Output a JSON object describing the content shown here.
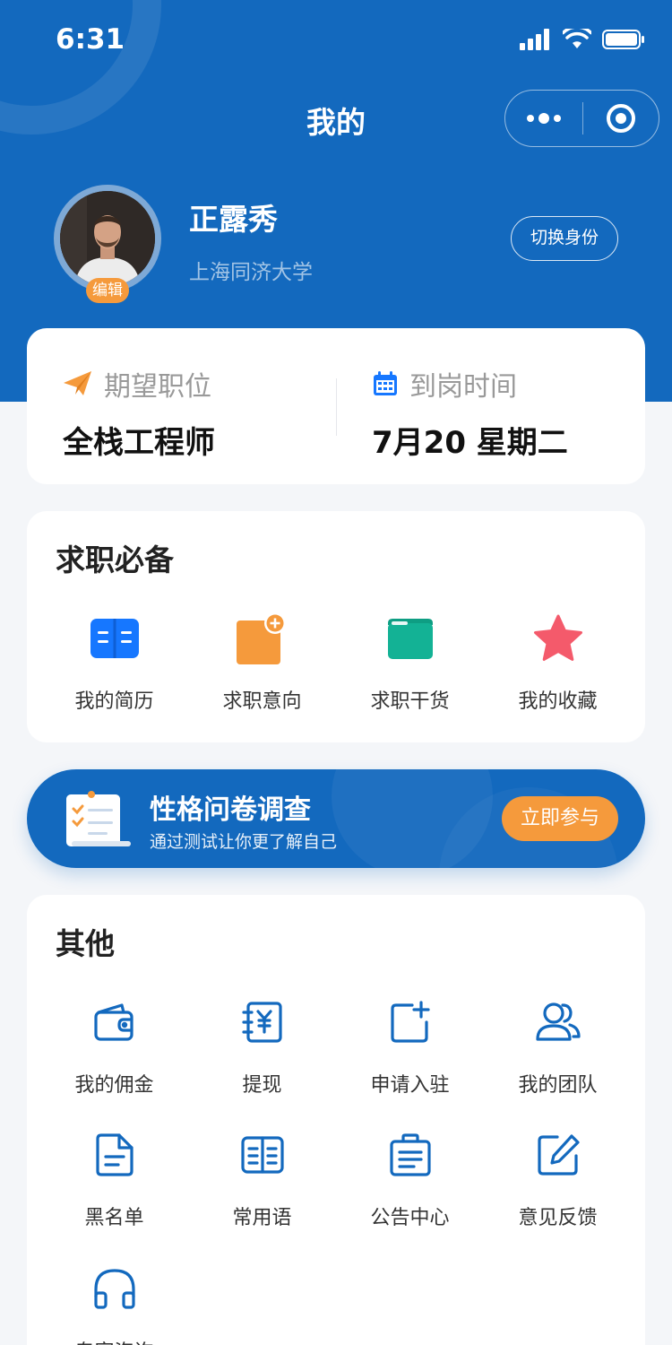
{
  "status_bar": {
    "time": "6:31"
  },
  "nav": {
    "title": "我的"
  },
  "profile": {
    "name": "正露秀",
    "school": "上海同济大学",
    "edit_label": "编辑",
    "switch_label": "切换身份"
  },
  "expectation": {
    "position_label": "期望职位",
    "position_value": "全栈工程师",
    "arrival_label": "到岗时间",
    "arrival_value": "7月20 星期二"
  },
  "job_section": {
    "title": "求职必备",
    "items": [
      {
        "label": "我的简历",
        "icon": "resume-icon",
        "color": "#1677FF"
      },
      {
        "label": "求职意向",
        "icon": "intention-icon",
        "color": "#F59A3C"
      },
      {
        "label": "求职干货",
        "icon": "folder-icon",
        "color": "#13B295"
      },
      {
        "label": "我的收藏",
        "icon": "star-icon",
        "color": "#F45A6B"
      }
    ]
  },
  "banner": {
    "title": "性格问卷调查",
    "subtitle": "通过测试让你更了解自己",
    "button": "立即参与"
  },
  "other_section": {
    "title": "其他",
    "items": [
      {
        "label": "我的佣金",
        "icon": "wallet-icon"
      },
      {
        "label": "提现",
        "icon": "withdraw-icon"
      },
      {
        "label": "申请入驻",
        "icon": "apply-icon"
      },
      {
        "label": "我的团队",
        "icon": "team-icon"
      },
      {
        "label": "黑名单",
        "icon": "blacklist-icon"
      },
      {
        "label": "常用语",
        "icon": "phrases-icon"
      },
      {
        "label": "公告中心",
        "icon": "notice-icon"
      },
      {
        "label": "意见反馈",
        "icon": "feedback-icon"
      },
      {
        "label": "专家咨询",
        "icon": "headset-icon"
      }
    ]
  },
  "colors": {
    "primary": "#1369BE",
    "accent_orange": "#F59A3C",
    "page_bg": "#F4F6F9"
  }
}
